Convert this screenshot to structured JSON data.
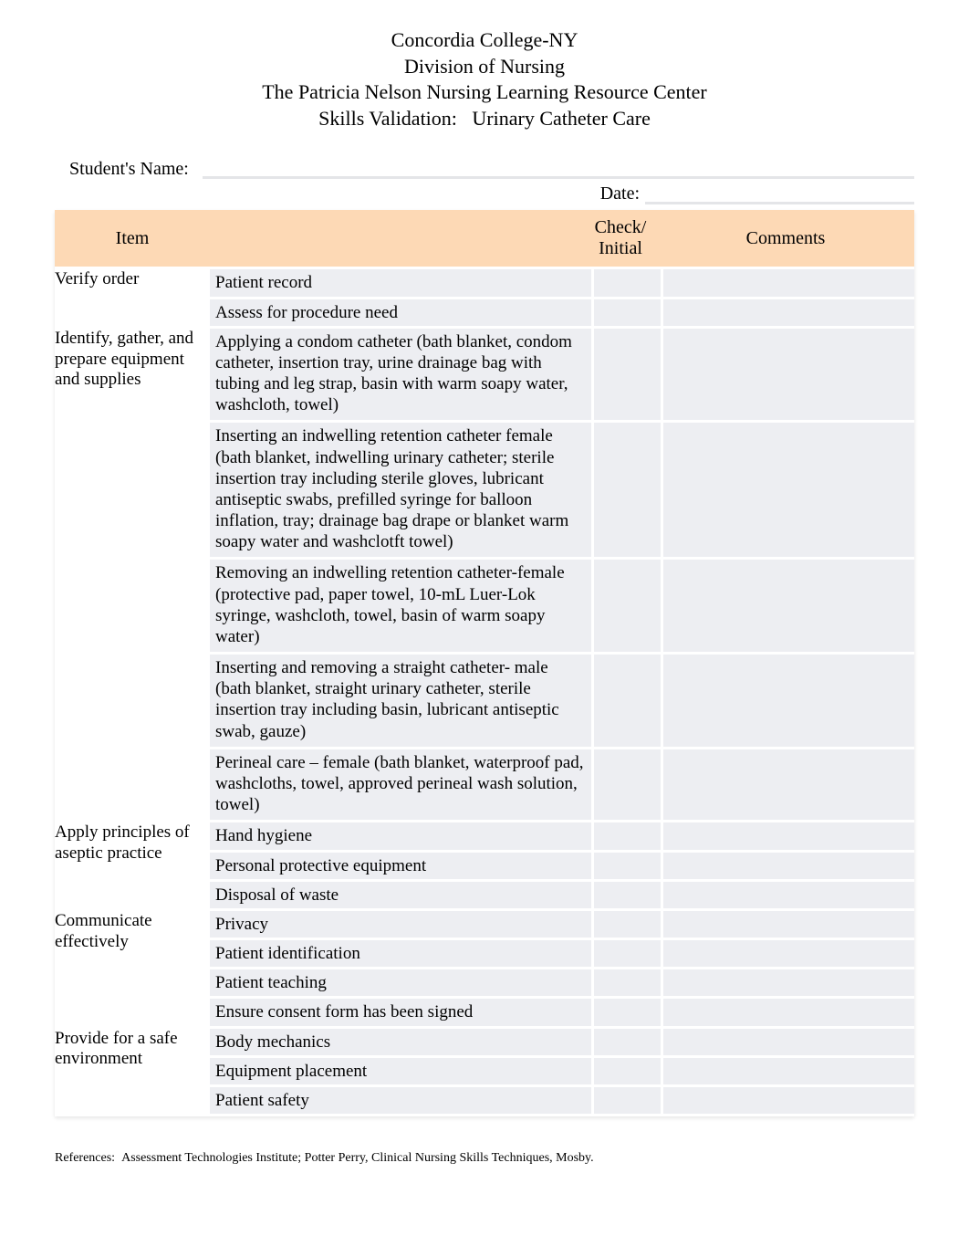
{
  "header": {
    "line1": "Concordia College-NY",
    "line2": "Division of Nursing",
    "line3": "The Patricia Nelson Nursing Learning Resource Center",
    "line4_prefix": "Skills Validation:",
    "line4_subject": "Urinary Catheter Care"
  },
  "fields": {
    "student_label": "Student's Name:",
    "student_value": "",
    "date_label": "Date:",
    "date_value": ""
  },
  "table": {
    "headers": {
      "item": "Item",
      "desc": "",
      "check": "Check/ Initial",
      "comments": "Comments"
    },
    "groups": [
      {
        "item": "Verify order",
        "rows": [
          {
            "text": "Patient record",
            "check": "",
            "comment": ""
          },
          {
            "text": "Assess for procedure need",
            "check": "",
            "comment": ""
          }
        ]
      },
      {
        "item": "Identify, gather, and prepare equipment and supplies",
        "rows": [
          {
            "text": "Applying a condom catheter (bath blanket, condom catheter, insertion tray, urine drainage bag with tubing and leg strap, basin with warm soapy water, washcloth, towel)",
            "check": "",
            "comment": ""
          },
          {
            "text": "Inserting an indwelling retention catheter female (bath blanket, indwelling urinary catheter; sterile insertion tray including sterile gloves, lubricant antiseptic swabs, prefilled syringe for balloon inflation, tray; drainage bag drape or blanket warm soapy water and washclotft towel)",
            "check": "",
            "comment": ""
          },
          {
            "text": "Removing an indwelling retention catheter-female (protective pad, paper towel, 10-mL Luer-Lok syringe, washcloth, towel, basin of warm soapy water)",
            "check": "",
            "comment": ""
          },
          {
            "text": "Inserting and removing a straight catheter- male (bath blanket, straight urinary catheter, sterile insertion tray including basin, lubricant antiseptic swab, gauze)",
            "check": "",
            "comment": ""
          },
          {
            "text": "Perineal care – female (bath blanket, waterproof pad, washcloths, towel, approved perineal wash solution, towel)",
            "check": "",
            "comment": ""
          }
        ]
      },
      {
        "item": "Apply principles of aseptic practice",
        "rows": [
          {
            "text": "Hand hygiene",
            "check": "",
            "comment": ""
          },
          {
            "text": "Personal protective equipment",
            "check": "",
            "comment": ""
          },
          {
            "text": "Disposal of waste",
            "check": "",
            "comment": ""
          }
        ]
      },
      {
        "item": "Communicate effectively",
        "rows": [
          {
            "text": "Privacy",
            "check": "",
            "comment": ""
          },
          {
            "text": "Patient identification",
            "check": "",
            "comment": ""
          },
          {
            "text": "Patient teaching",
            "check": "",
            "comment": ""
          },
          {
            "text": "Ensure consent form has been signed",
            "check": "",
            "comment": ""
          }
        ]
      },
      {
        "item": "Provide for a safe environment",
        "rows": [
          {
            "text": "Body mechanics",
            "check": "",
            "comment": ""
          },
          {
            "text": "Equipment placement",
            "check": "",
            "comment": ""
          },
          {
            "text": "Patient safety",
            "check": "",
            "comment": ""
          }
        ]
      }
    ]
  },
  "references_label": "References:",
  "references_text": "Assessment Technologies Institute; Potter Perry, Clinical Nursing Skills Techniques, Mosby."
}
